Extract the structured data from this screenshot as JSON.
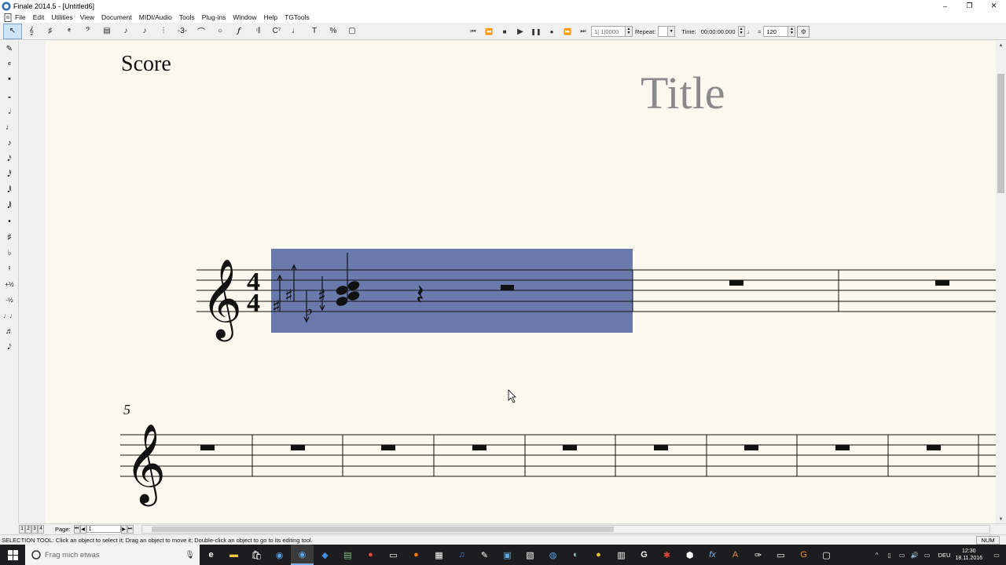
{
  "window": {
    "title": "Finale 2014.5 - [Untitled6]",
    "controls": [
      "–",
      "❐",
      "✕"
    ]
  },
  "menubar": {
    "items": [
      "File",
      "Edit",
      "Utilities",
      "View",
      "Document",
      "MIDI/Audio",
      "Tools",
      "Plug-ins",
      "Window",
      "Help",
      "TGTools"
    ]
  },
  "toolbar": {
    "tools": [
      "selection-tool",
      "staff-tool",
      "key-tool",
      "time-tool",
      "clef-tool",
      "measure-tool",
      "simple-entry-tool",
      "speedy-entry-tool",
      "chord-tool",
      "tuplet-tool",
      "smart-shape-tool",
      "articulation-tool",
      "expression-tool",
      "repeat-tool",
      "chord-symbol-tool",
      "lyrics-tool",
      "text-tool",
      "resize-tool",
      "page-layout-tool"
    ],
    "tool_glyphs": [
      "↖",
      "𝄞",
      "♯",
      "𝄵",
      "𝄢",
      "▤",
      "♪",
      "♪",
      "⫶",
      "-3-",
      "⌒",
      "○",
      "𝆑",
      "𝄇",
      "C⁷",
      "♩",
      "T",
      "%",
      "▢"
    ],
    "playback": {
      "counter": "1| 1|0000",
      "repeat_label": "Repeat:",
      "time_label": "Time:",
      "time_value": "00:00:00.000",
      "tempo_eq": "=",
      "tempo_value": "120"
    }
  },
  "palette": {
    "glyphs": [
      "✎",
      "𝄴",
      "𝄺",
      "𝅝",
      "𝅗𝅥",
      "♩",
      "♪",
      "𝅘𝅥𝅯",
      "𝅘𝅥𝅰",
      "𝅘𝅥𝅱",
      "𝅘𝅥𝅲",
      "•",
      "♯",
      "♭",
      "♮",
      "+½",
      "-½",
      "♩♩",
      "♬",
      "𝅘𝅥𝅮"
    ]
  },
  "score": {
    "part_label": "Score",
    "title": "Title",
    "system2_measure_number": "5"
  },
  "pagenav": {
    "tabs": [
      "1",
      "2",
      "3",
      "4"
    ],
    "page_label": "Page:",
    "page_value": "1"
  },
  "statusbar": {
    "message": "SELECTION TOOL: Click an object to select it; Drag an object to move it; Double-click an object to go to its editing tool.",
    "num": "NUM"
  },
  "taskbar": {
    "search_placeholder": "Frag mich etwas",
    "language": "DEU",
    "time": "12:30",
    "date": "18.11.2016"
  },
  "colors": {
    "selection": "#6b7aad",
    "paper": "#fbf9ef",
    "title_gray": "#8a8a8a",
    "taskbar": "#1d1d1f"
  }
}
